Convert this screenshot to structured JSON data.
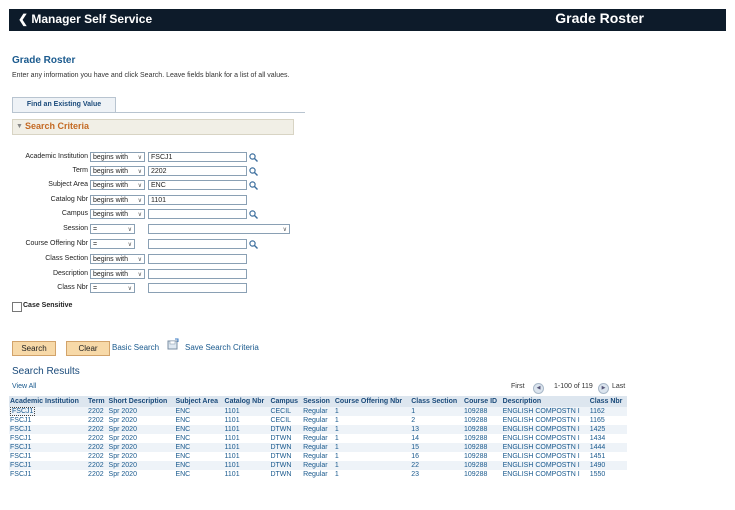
{
  "header": {
    "back_label": "Manager Self Service",
    "title": "Grade Roster"
  },
  "page": {
    "title": "Grade Roster",
    "instructions": "Enter any information you have and click Search. Leave fields blank for a list of all values.",
    "tab_label": "Find an Existing Value",
    "criteria_label": "Search Criteria"
  },
  "fields": [
    {
      "label": "Academic Institution",
      "operator": "begins with",
      "value": "FSCJ1",
      "lookup": true
    },
    {
      "label": "Term",
      "operator": "begins with",
      "value": "2202",
      "lookup": true
    },
    {
      "label": "Subject Area",
      "operator": "begins with",
      "value": "ENC",
      "lookup": true
    },
    {
      "label": "Catalog Nbr",
      "operator": "begins with",
      "value": "1101",
      "lookup": false
    },
    {
      "label": "Campus",
      "operator": "begins with",
      "value": "",
      "lookup": true
    },
    {
      "label": "Session",
      "operator": "=",
      "value": "",
      "lookup": false
    },
    {
      "label": "Course Offering Nbr",
      "operator": "=",
      "value": "",
      "lookup": true
    },
    {
      "label": "Class Section",
      "operator": "begins with",
      "value": "",
      "lookup": false
    },
    {
      "label": "Description",
      "operator": "begins with",
      "value": "",
      "lookup": false
    },
    {
      "label": "Class Nbr",
      "operator": "=",
      "value": "",
      "lookup": false
    }
  ],
  "case_sensitive_label": "Case Sensitive",
  "buttons": {
    "search": "Search",
    "clear": "Clear",
    "basic_search": "Basic Search",
    "save_criteria": "Save Search Criteria"
  },
  "results": {
    "title": "Search Results",
    "view_all": "View All",
    "first": "First",
    "range": "1-100 of 119",
    "last": "Last",
    "columns": [
      "Academic Institution",
      "Term",
      "Short Description",
      "Subject Area",
      "Catalog Nbr",
      "Campus",
      "Session",
      "Course Offering Nbr",
      "Class Section",
      "Course ID",
      "Description",
      "Class Nbr"
    ],
    "rows": [
      [
        "FSCJ1",
        "2202",
        "Spr 2020",
        "ENC",
        "1101",
        "CECIL",
        "Regular",
        "1",
        "1",
        "109288",
        "ENGLISH COMPOSTN I",
        "1162"
      ],
      [
        "FSCJ1",
        "2202",
        "Spr 2020",
        "ENC",
        "1101",
        "CECIL",
        "Regular",
        "1",
        "2",
        "109288",
        "ENGLISH COMPOSTN I",
        "1165"
      ],
      [
        "FSCJ1",
        "2202",
        "Spr 2020",
        "ENC",
        "1101",
        "DTWN",
        "Regular",
        "1",
        "13",
        "109288",
        "ENGLISH COMPOSTN I",
        "1425"
      ],
      [
        "FSCJ1",
        "2202",
        "Spr 2020",
        "ENC",
        "1101",
        "DTWN",
        "Regular",
        "1",
        "14",
        "109288",
        "ENGLISH COMPOSTN I",
        "1434"
      ],
      [
        "FSCJ1",
        "2202",
        "Spr 2020",
        "ENC",
        "1101",
        "DTWN",
        "Regular",
        "1",
        "15",
        "109288",
        "ENGLISH COMPOSTN I",
        "1444"
      ],
      [
        "FSCJ1",
        "2202",
        "Spr 2020",
        "ENC",
        "1101",
        "DTWN",
        "Regular",
        "1",
        "16",
        "109288",
        "ENGLISH COMPOSTN I",
        "1451"
      ],
      [
        "FSCJ1",
        "2202",
        "Spr 2020",
        "ENC",
        "1101",
        "DTWN",
        "Regular",
        "1",
        "22",
        "109288",
        "ENGLISH COMPOSTN I",
        "1490"
      ],
      [
        "FSCJ1",
        "2202",
        "Spr 2020",
        "ENC",
        "1101",
        "DTWN",
        "Regular",
        "1",
        "23",
        "109288",
        "ENGLISH COMPOSTN I",
        "1550"
      ]
    ]
  }
}
